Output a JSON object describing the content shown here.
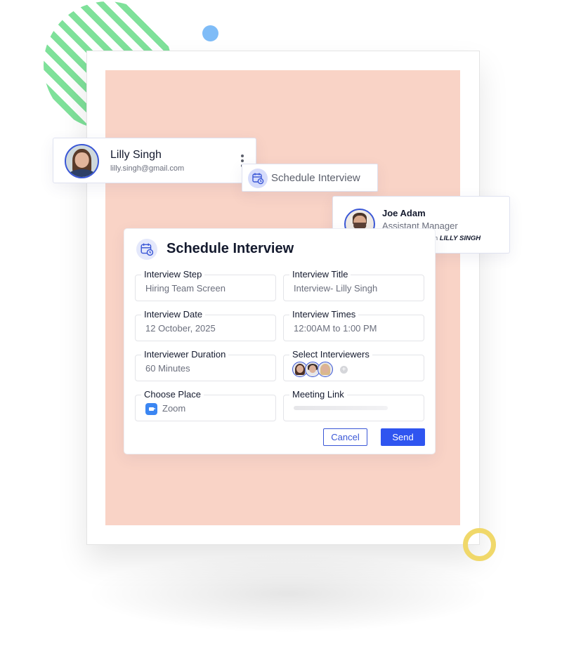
{
  "colors": {
    "accent": "#2f55f0",
    "canvas_bg": "#f9d3c6",
    "deco_green": "#7fe19a",
    "deco_blue": "#7fbcf7",
    "deco_yellow": "#f0d86a"
  },
  "candidate_card": {
    "name": "Lilly Singh",
    "email": "lilly.singh@gmail.com",
    "menu_icon": "kebab-menu-icon"
  },
  "schedule_chip": {
    "icon": "calendar-clock-icon",
    "label": "Schedule Interview"
  },
  "interviewer_card": {
    "name": "Joe Adam",
    "role": "Assistant Manager",
    "note_prefix": "New Interview with",
    "note_highlight": "LILLY SINGH"
  },
  "form": {
    "icon": "calendar-clock-icon",
    "title": "Schedule Interview",
    "fields": [
      {
        "label": "Interview Step",
        "value": "Hiring Team Screen"
      },
      {
        "label": "Interview Title",
        "value": "Interview- Lilly Singh"
      },
      {
        "label": "Interview Date",
        "value": "12 October, 2025"
      },
      {
        "label": "Interview Times",
        "value": "12:00AM to 1:00 PM"
      },
      {
        "label": "Interviewer Duration",
        "value": "60 Minutes"
      },
      {
        "label": "Select Interviewers",
        "value": ""
      },
      {
        "label": "Choose Place",
        "value": "Zoom",
        "icon": "zoom-icon"
      },
      {
        "label": "Meeting Link",
        "value": ""
      }
    ],
    "interviewers_selected": 3,
    "add_interviewer_icon": "plus-icon",
    "cancel_label": "Cancel",
    "send_label": "Send"
  }
}
